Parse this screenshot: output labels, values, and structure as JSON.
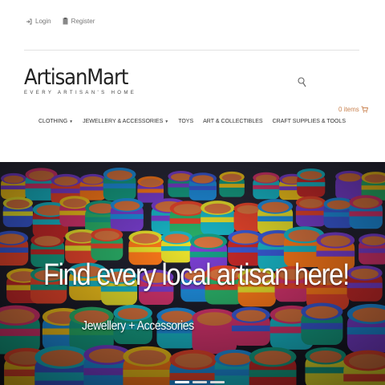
{
  "topbar": {
    "login": "Login",
    "register": "Register"
  },
  "brand": {
    "name": "ArtisanMart",
    "tagline": "EVERY ARTISAN'S HOME"
  },
  "cart": {
    "label": "0 items"
  },
  "nav": {
    "clothing": "CLOTHING",
    "jewellery": "JEWELLERY & ACCESSORIES",
    "toys": "TOYS",
    "art": "ART & COLLECTIBLES",
    "craft": "CRAFT SUPPLIES & TOOLS"
  },
  "hero": {
    "headline": "Find every local artisan here!",
    "subline": "Jewellery + Accessories",
    "slide_count": 3,
    "active_slide": 1
  },
  "colors": {
    "accent": "#c9824f",
    "text": "#333333"
  },
  "icons": [
    "login-icon",
    "register-icon",
    "search-icon",
    "cart-icon",
    "caret-down-icon"
  ]
}
